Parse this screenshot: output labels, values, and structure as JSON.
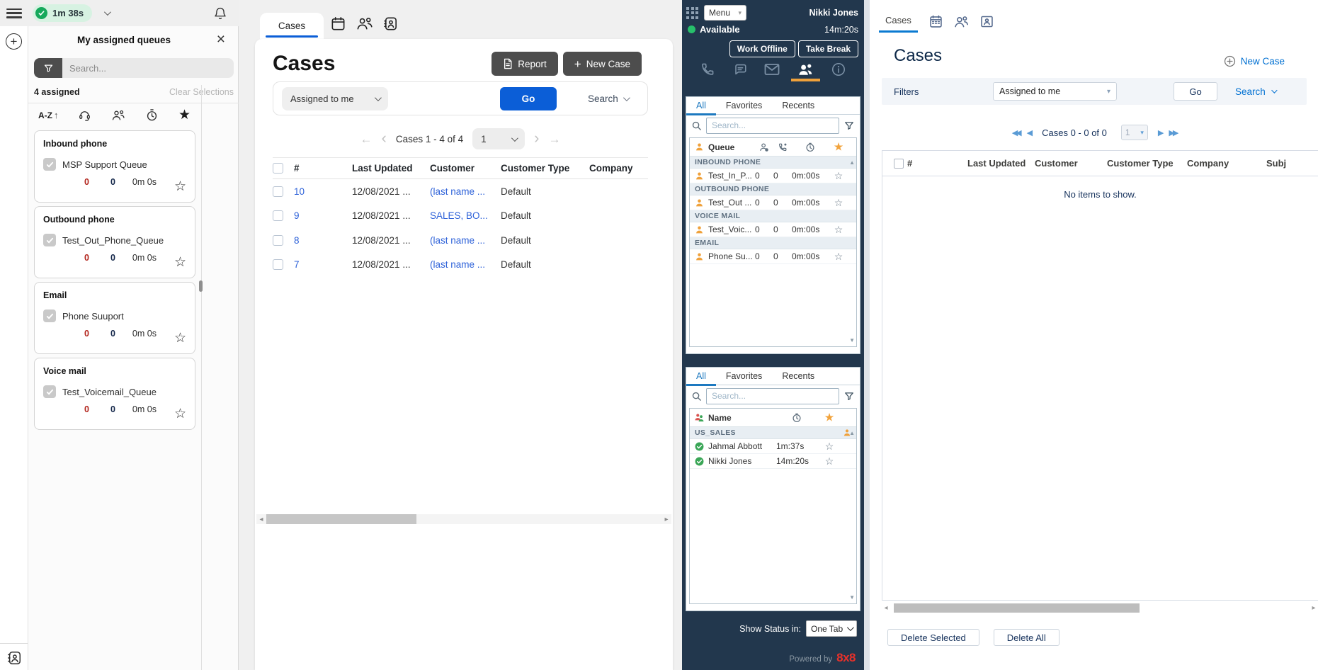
{
  "topbar": {
    "timer": "1m 38s"
  },
  "queues_panel": {
    "title": "My assigned queues",
    "search_placeholder": "Search...",
    "assigned_count": "4 assigned",
    "clear_selections": "Clear Selections",
    "sort_label": "A-Z",
    "cards": [
      {
        "media_type": "Inbound phone",
        "queue_name": "MSP Support Queue",
        "waiting": "0",
        "active": "0",
        "wait_time": "0m 0s"
      },
      {
        "media_type": "Outbound phone",
        "queue_name": "Test_Out_Phone_Queue",
        "waiting": "0",
        "active": "0",
        "wait_time": "0m 0s"
      },
      {
        "media_type": "Email",
        "queue_name": "Phone Suuport",
        "waiting": "0",
        "active": "0",
        "wait_time": "0m 0s"
      },
      {
        "media_type": "Voice mail",
        "queue_name": "Test_Voicemail_Queue",
        "waiting": "0",
        "active": "0",
        "wait_time": "0m 0s"
      }
    ]
  },
  "cases_panel": {
    "tab_label": "Cases",
    "title": "Cases",
    "report_button": "Report",
    "new_case_button": "New Case",
    "filter_value": "Assigned to me",
    "go_button": "Go",
    "search_label": "Search",
    "pagination_text": "Cases 1 - 4 of 4",
    "page_value": "1",
    "columns": [
      "#",
      "Last Updated",
      "Customer",
      "Customer Type",
      "Company"
    ],
    "rows": [
      {
        "id": "10",
        "last_updated": "12/08/2021 ...",
        "customer": "(last name ...",
        "customer_type": "Default",
        "company": ""
      },
      {
        "id": "9",
        "last_updated": "12/08/2021 ...",
        "customer": "SALES, BO...",
        "customer_type": "Default",
        "company": ""
      },
      {
        "id": "8",
        "last_updated": "12/08/2021 ...",
        "customer": "(last name ...",
        "customer_type": "Default",
        "company": ""
      },
      {
        "id": "7",
        "last_updated": "12/08/2021 ...",
        "customer": "(last name ...",
        "customer_type": "Default",
        "company": ""
      }
    ]
  },
  "agent_panel": {
    "menu_button": "Menu",
    "agent_name": "Nikki Jones",
    "status": "Available",
    "status_timer": "14m:20s",
    "work_offline_button": "Work Offline",
    "take_break_button": "Take Break",
    "queues": {
      "tabs": [
        "All",
        "Favorites",
        "Recents"
      ],
      "search_placeholder": "Search...",
      "header": "Queue",
      "groups": [
        {
          "label": "INBOUND PHONE",
          "row": {
            "name": "Test_In_P...",
            "waiting": "0",
            "active": "0",
            "time": "0m:00s"
          }
        },
        {
          "label": "OUTBOUND PHONE",
          "row": {
            "name": "Test_Out ...",
            "waiting": "0",
            "active": "0",
            "time": "0m:00s"
          }
        },
        {
          "label": "VOICE MAIL",
          "row": {
            "name": "Test_Voic...",
            "waiting": "0",
            "active": "0",
            "time": "0m:00s"
          }
        },
        {
          "label": "EMAIL",
          "row": {
            "name": "Phone Su...",
            "waiting": "0",
            "active": "0",
            "time": "0m:00s"
          }
        }
      ]
    },
    "agents": {
      "tabs": [
        "All",
        "Favorites",
        "Recents"
      ],
      "search_placeholder": "Search...",
      "header": "Name",
      "group_label": "US_SALES",
      "rows": [
        {
          "name": "Jahmal Abbott",
          "time": "1m:37s"
        },
        {
          "name": "Nikki Jones",
          "time": "14m:20s"
        }
      ]
    },
    "show_status_label": "Show Status in:",
    "show_status_value": "One Tab",
    "powered_by": "Powered by",
    "brand": "8x8"
  },
  "crm_panel": {
    "tab_label": "Cases",
    "title": "Cases",
    "new_case_link": "New Case",
    "filters_label": "Filters",
    "filter_value": "Assigned to me",
    "go_button": "Go",
    "search_label": "Search",
    "pagination_text": "Cases 0 - 0 of 0",
    "page_value": "1",
    "columns": [
      "#",
      "Last Updated",
      "Customer",
      "Customer Type",
      "Company",
      "Subj"
    ],
    "empty_message": "No items to show.",
    "delete_selected_button": "Delete Selected",
    "delete_all_button": "Delete All"
  },
  "glyphs": {
    "close": "×",
    "sort_arrow_up": "↑",
    "star_filled": "★",
    "star_outline": "☆",
    "arrow_left": "←",
    "arrow_right": "→",
    "chevron_left": "‹",
    "chevron_right": "›",
    "select_caret": "▾",
    "tri_up": "▲",
    "tri_down": "▼",
    "tri_left": "◂",
    "tri_right": "▸",
    "page_first": "◀◀",
    "page_prev": "◀",
    "page_next": "▶",
    "page_last": "▶▶"
  },
  "colors": {
    "accent_blue": "#0b5ed7",
    "link_blue": "#2e62d9",
    "crm_blue": "#0070d2",
    "dark_panel_bg": "#22374d",
    "orange": "#efa13b",
    "green": "#27c06b",
    "brand_red": "#e8312a"
  }
}
